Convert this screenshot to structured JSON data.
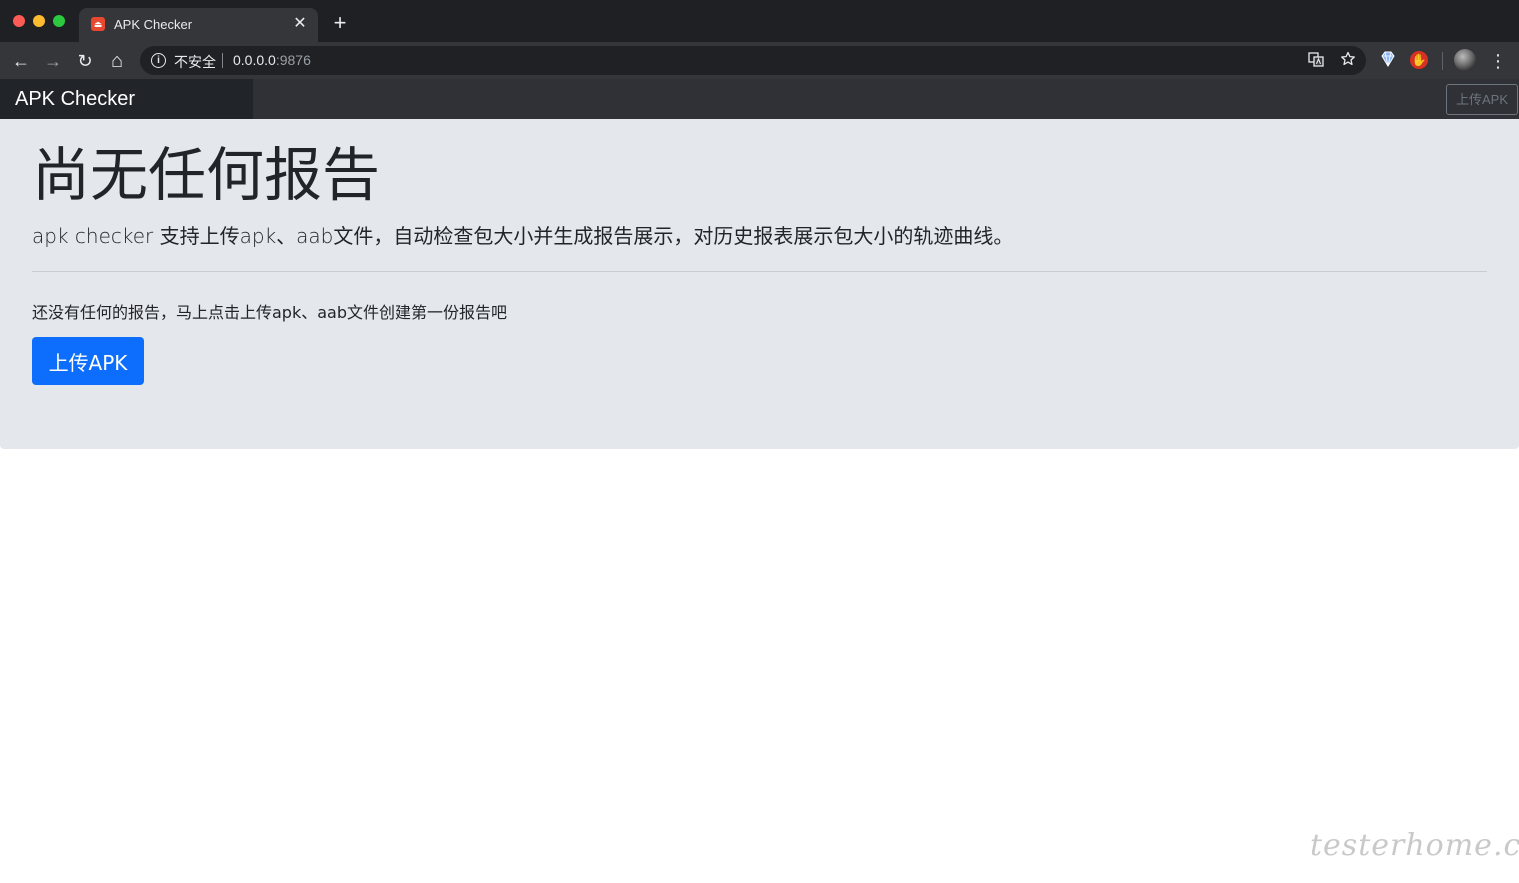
{
  "browser": {
    "tab": {
      "title": "APK Checker",
      "favicon_color": "#e8482f",
      "close_glyph": "✕"
    },
    "new_tab_glyph": "+",
    "nav": {
      "back": "←",
      "forward": "→",
      "reload": "↻",
      "home": "⌂"
    },
    "omnibox": {
      "security_label": "不安全",
      "url_host": "0.0.0.0",
      "url_port": ":9876"
    },
    "menu_glyph": "⋮"
  },
  "app": {
    "brand": "APK Checker",
    "nav_upload_label": "上传APK",
    "jumbotron": {
      "title": "尚无任何报告",
      "lead": "apk checker 支持上传apk、aab文件，自动检查包大小并生成报告展示，对历史报表展示包大小的轨迹曲线。",
      "empty_text": "还没有任何的报告，马上点击上传apk、aab文件创建第一份报告吧",
      "upload_button_label": "上传APK"
    },
    "colors": {
      "primary": "#0d6efd",
      "jumbotron_bg": "#e4e7ec",
      "navbar_bg": "#2f3136"
    }
  },
  "watermark": "testerhome.com"
}
